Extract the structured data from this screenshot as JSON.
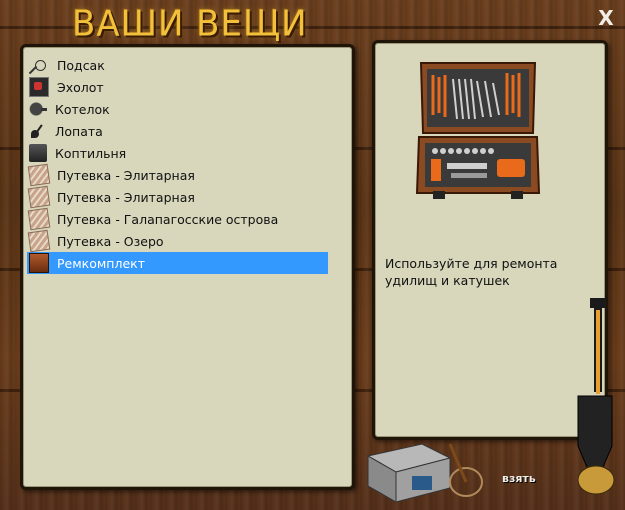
{
  "title": "ВАШИ ВЕЩИ",
  "close_label": "X",
  "items": [
    {
      "label": "Подсак",
      "icon": "landing-net-icon",
      "selected": false
    },
    {
      "label": "Эхолот",
      "icon": "echo-sounder-icon",
      "selected": false
    },
    {
      "label": "Котелок",
      "icon": "pot-icon",
      "selected": false
    },
    {
      "label": "Лопата",
      "icon": "shovel-icon",
      "selected": false
    },
    {
      "label": "Коптильня",
      "icon": "smokehouse-icon",
      "selected": false
    },
    {
      "label": "Путевка - Элитарная",
      "icon": "voucher-icon",
      "selected": false
    },
    {
      "label": "Путевка - Элитарная",
      "icon": "voucher-icon",
      "selected": false
    },
    {
      "label": "Путевка - Галапагосские острова",
      "icon": "voucher-icon",
      "selected": false
    },
    {
      "label": "Путевка - Озеро",
      "icon": "voucher-icon",
      "selected": false
    },
    {
      "label": "Ремкомплект",
      "icon": "repair-kit-icon",
      "selected": true
    }
  ],
  "detail": {
    "description": "Используйте для ремонта удилищ и катушек",
    "image_icon": "toolbox-icon"
  },
  "take_label": "взять",
  "colors": {
    "selection": "#3399ff",
    "title": "#f2c03a",
    "panel": "#d8d6bb"
  }
}
